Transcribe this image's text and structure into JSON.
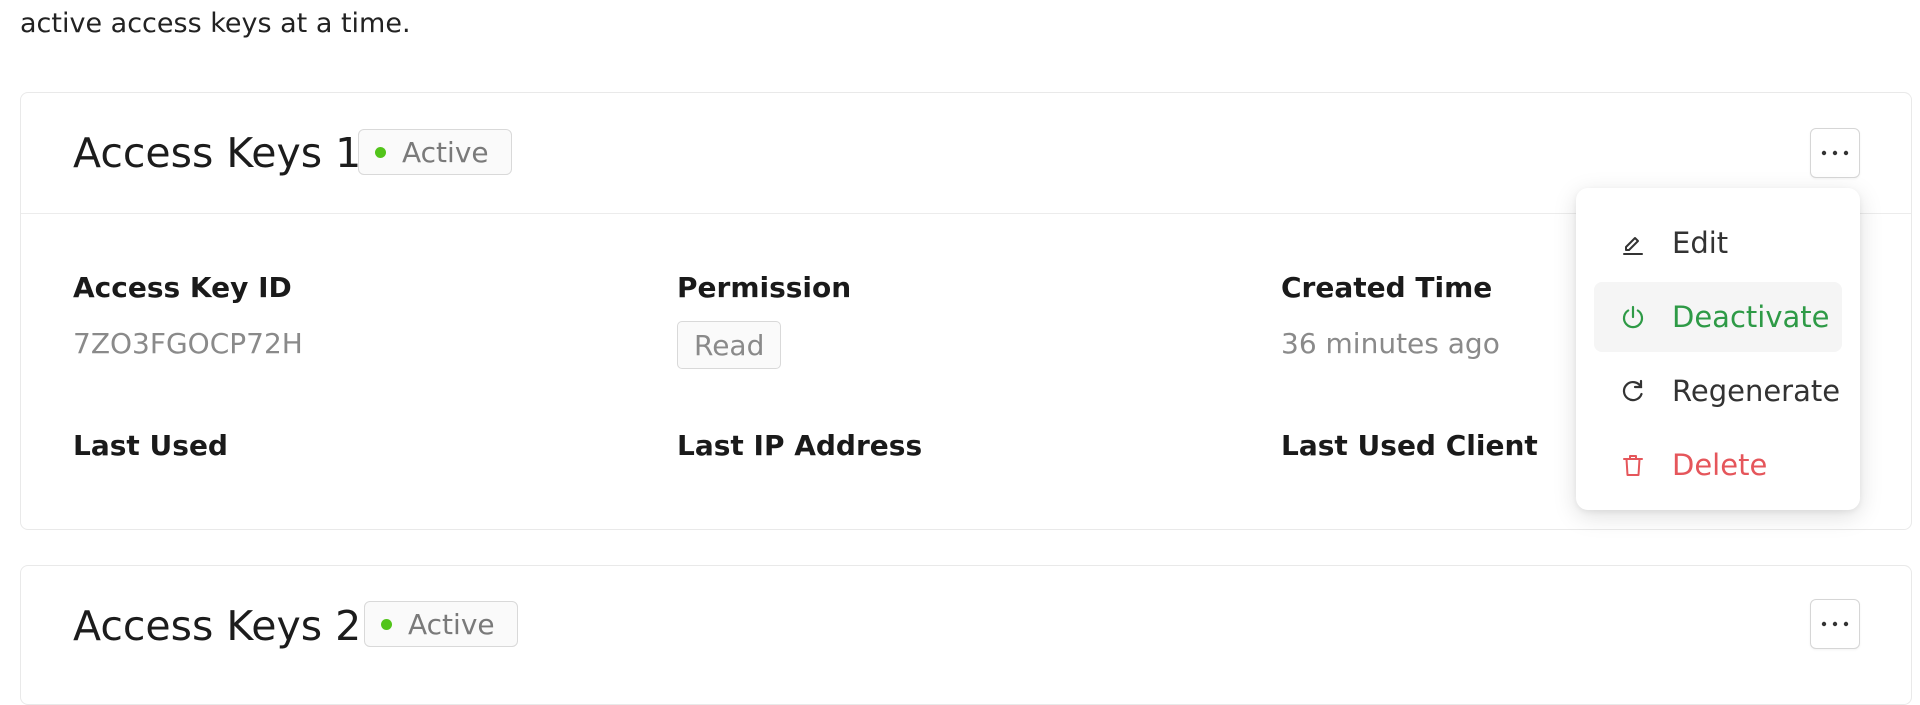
{
  "intro_text": "active access keys at a time.",
  "cards": [
    {
      "title": "Access Keys 1",
      "status": "Active",
      "fields": {
        "access_key_id_label": "Access Key ID",
        "access_key_id_value": "7ZO3FGOCP72H",
        "permission_label": "Permission",
        "permission_value": "Read",
        "created_time_label": "Created Time",
        "created_time_value": "36 minutes ago",
        "last_used_label": "Last Used",
        "last_ip_label": "Last IP Address",
        "last_client_label": "Last Used Client"
      }
    },
    {
      "title": "Access Keys 2",
      "status": "Active"
    }
  ],
  "menu": {
    "items": [
      {
        "label": "Edit",
        "icon": "edit-icon",
        "color": "#333333"
      },
      {
        "label": "Deactivate",
        "icon": "power-icon",
        "color": "#2e9a46"
      },
      {
        "label": "Regenerate",
        "icon": "refresh-icon",
        "color": "#333333"
      },
      {
        "label": "Delete",
        "icon": "trash-icon",
        "color": "#e5565b"
      }
    ]
  },
  "colors": {
    "status_dot": "#52c41a",
    "deactivate": "#2e9a46",
    "delete": "#e5565b"
  }
}
